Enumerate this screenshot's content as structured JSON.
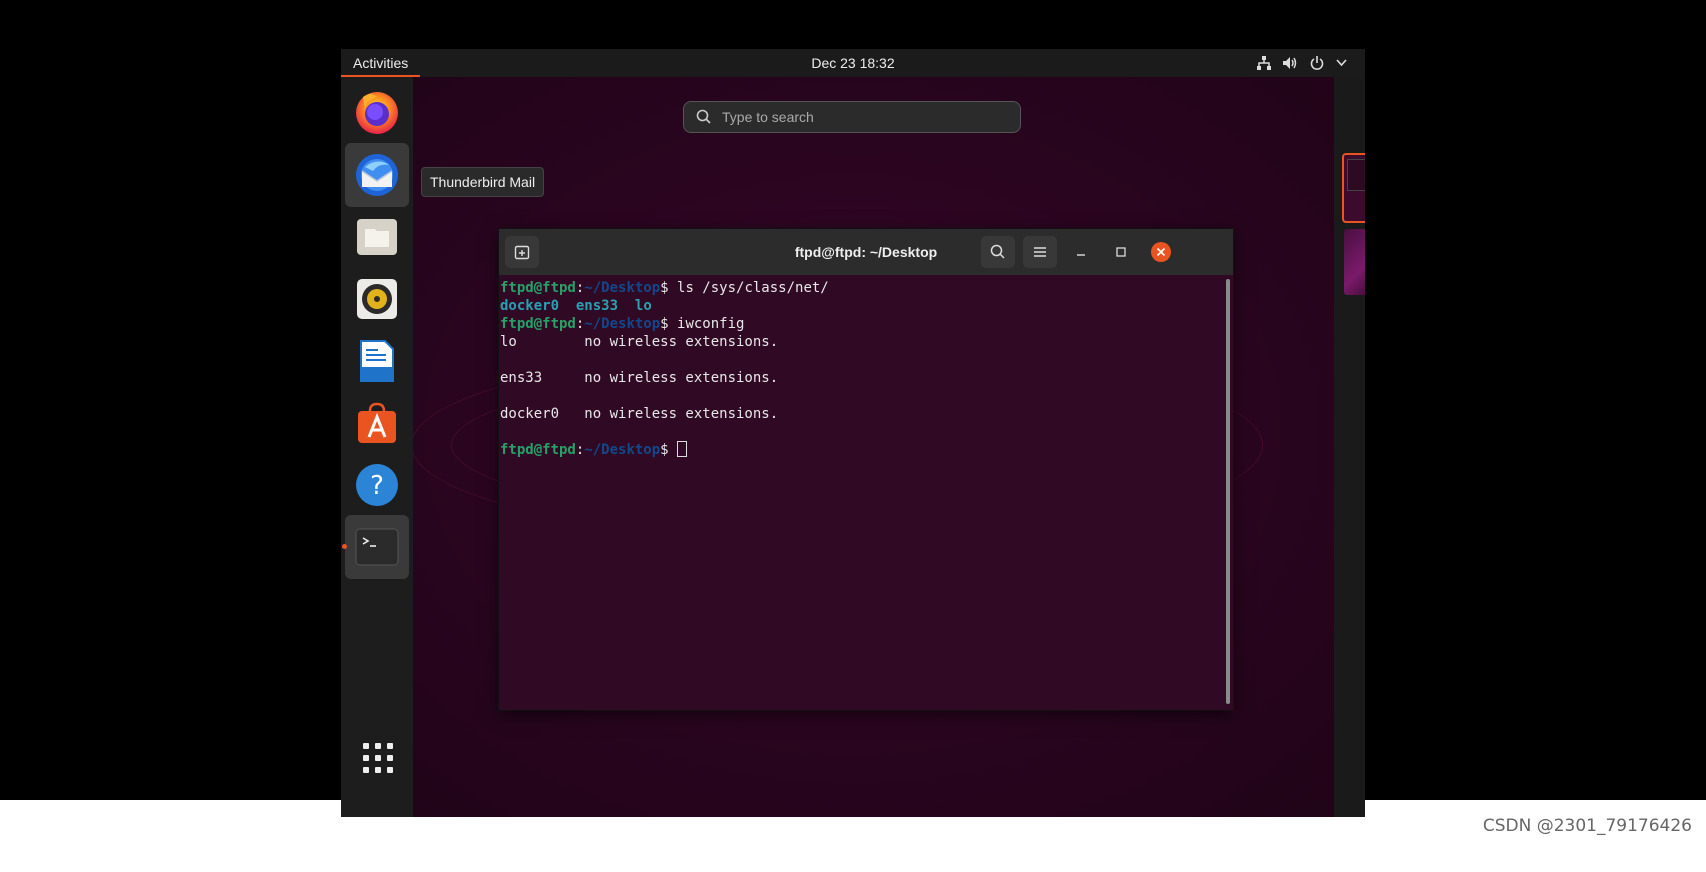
{
  "topbar": {
    "activities_label": "Activities",
    "clock": "Dec 23  18:32",
    "tray_icons": [
      "network-icon",
      "volume-icon",
      "power-icon",
      "chevron-down-icon"
    ]
  },
  "search": {
    "placeholder": "Type to search"
  },
  "tooltip": {
    "text": "Thunderbird Mail"
  },
  "dock": {
    "items": [
      {
        "name": "firefox-icon",
        "label": "Firefox"
      },
      {
        "name": "thunderbird-icon",
        "label": "Thunderbird Mail"
      },
      {
        "name": "files-icon",
        "label": "Files"
      },
      {
        "name": "rhythmbox-icon",
        "label": "Rhythmbox"
      },
      {
        "name": "libreoffice-writer-icon",
        "label": "LibreOffice Writer"
      },
      {
        "name": "ubuntu-software-icon",
        "label": "Ubuntu Software"
      },
      {
        "name": "help-icon",
        "label": "Help"
      },
      {
        "name": "terminal-icon",
        "label": "Terminal"
      }
    ],
    "apps_grid_icon": "show-applications-icon",
    "accent_color": "#e95420"
  },
  "terminal": {
    "title": "ftpd@ftpd: ~/Desktop",
    "user_host": "ftpd@ftpd",
    "path": "~/Desktop",
    "cmd1": "ls /sys/class/net/",
    "ls_out": [
      "docker0",
      "ens33",
      "lo"
    ],
    "cmd2": "iwconfig",
    "out_lo": "lo        no wireless extensions.",
    "out_ens33": "ens33     no wireless extensions.",
    "out_docker0": "docker0   no wireless extensions.",
    "colors": {
      "background": "#300a24",
      "user": "#26a269",
      "path": "#12488b",
      "dir": "#2aa1b3"
    }
  },
  "watermark": "CSDN @2301_79176426"
}
